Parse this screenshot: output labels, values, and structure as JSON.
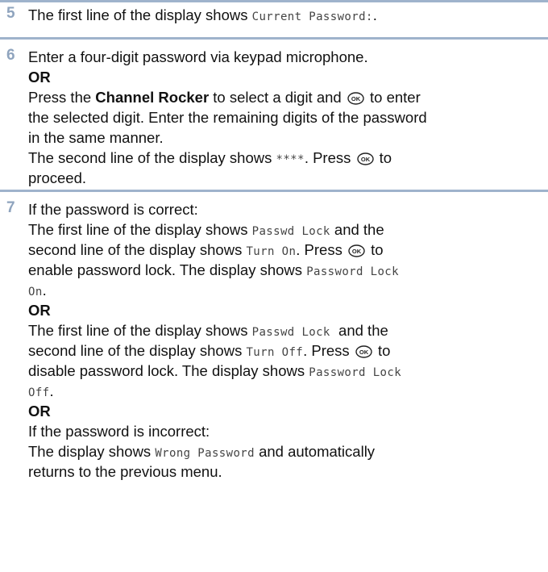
{
  "steps": [
    {
      "number": "5",
      "line1": {
        "pre": "The first line of the display shows ",
        "code": "Current Password:",
        "post": "."
      }
    },
    {
      "number": "6",
      "l1": "Enter a four-digit password via keypad microphone.",
      "or": "OR",
      "l3_pre": "Press the ",
      "l3_bold": "Channel Rocker",
      "l3_mid": " to select a digit and ",
      "l3_post": " to enter",
      "l4": "the selected digit. Enter the remaining digits of the password",
      "l5": "in the same manner.",
      "l6_pre": "The second line of the display shows ",
      "l6_code": "****",
      "l6_mid": ". Press ",
      "l6_post": " to",
      "l7": "proceed."
    },
    {
      "number": "7",
      "l1": "If the password is correct:",
      "l2_pre": "The first line of the display shows ",
      "l2_code": "Passwd Lock",
      "l2_post": " and the",
      "l3_pre": "second line of the display shows ",
      "l3_code": "Turn On",
      "l3_mid": ". Press ",
      "l3_post": " to",
      "l4_pre": "enable password lock. The display shows ",
      "l4_code": "Password Lock",
      "l5_code": "On",
      "l5_post": ".",
      "or1": "OR",
      "l7_pre": "The first line of the display shows ",
      "l7_code": "Passwd Lock",
      "l7_post": "  and the",
      "l8_pre": "second line of the display shows ",
      "l8_code": "Turn Off",
      "l8_mid": ". Press ",
      "l8_post": " to",
      "l9_pre": "disable password lock. The display shows ",
      "l9_code": "Password Lock",
      "l10_code": "Off",
      "l10_post": ".",
      "or2": "OR",
      "l12": "If the password is incorrect:",
      "l13_pre": "The display shows ",
      "l13_code": "Wrong Password",
      "l13_post": " and automatically",
      "l14": "returns to the previous menu."
    }
  ],
  "icons": {
    "ok_button": "ok-button-icon"
  },
  "colors": {
    "step_number": "#8fa4be",
    "divider": "#9fb3cc"
  }
}
